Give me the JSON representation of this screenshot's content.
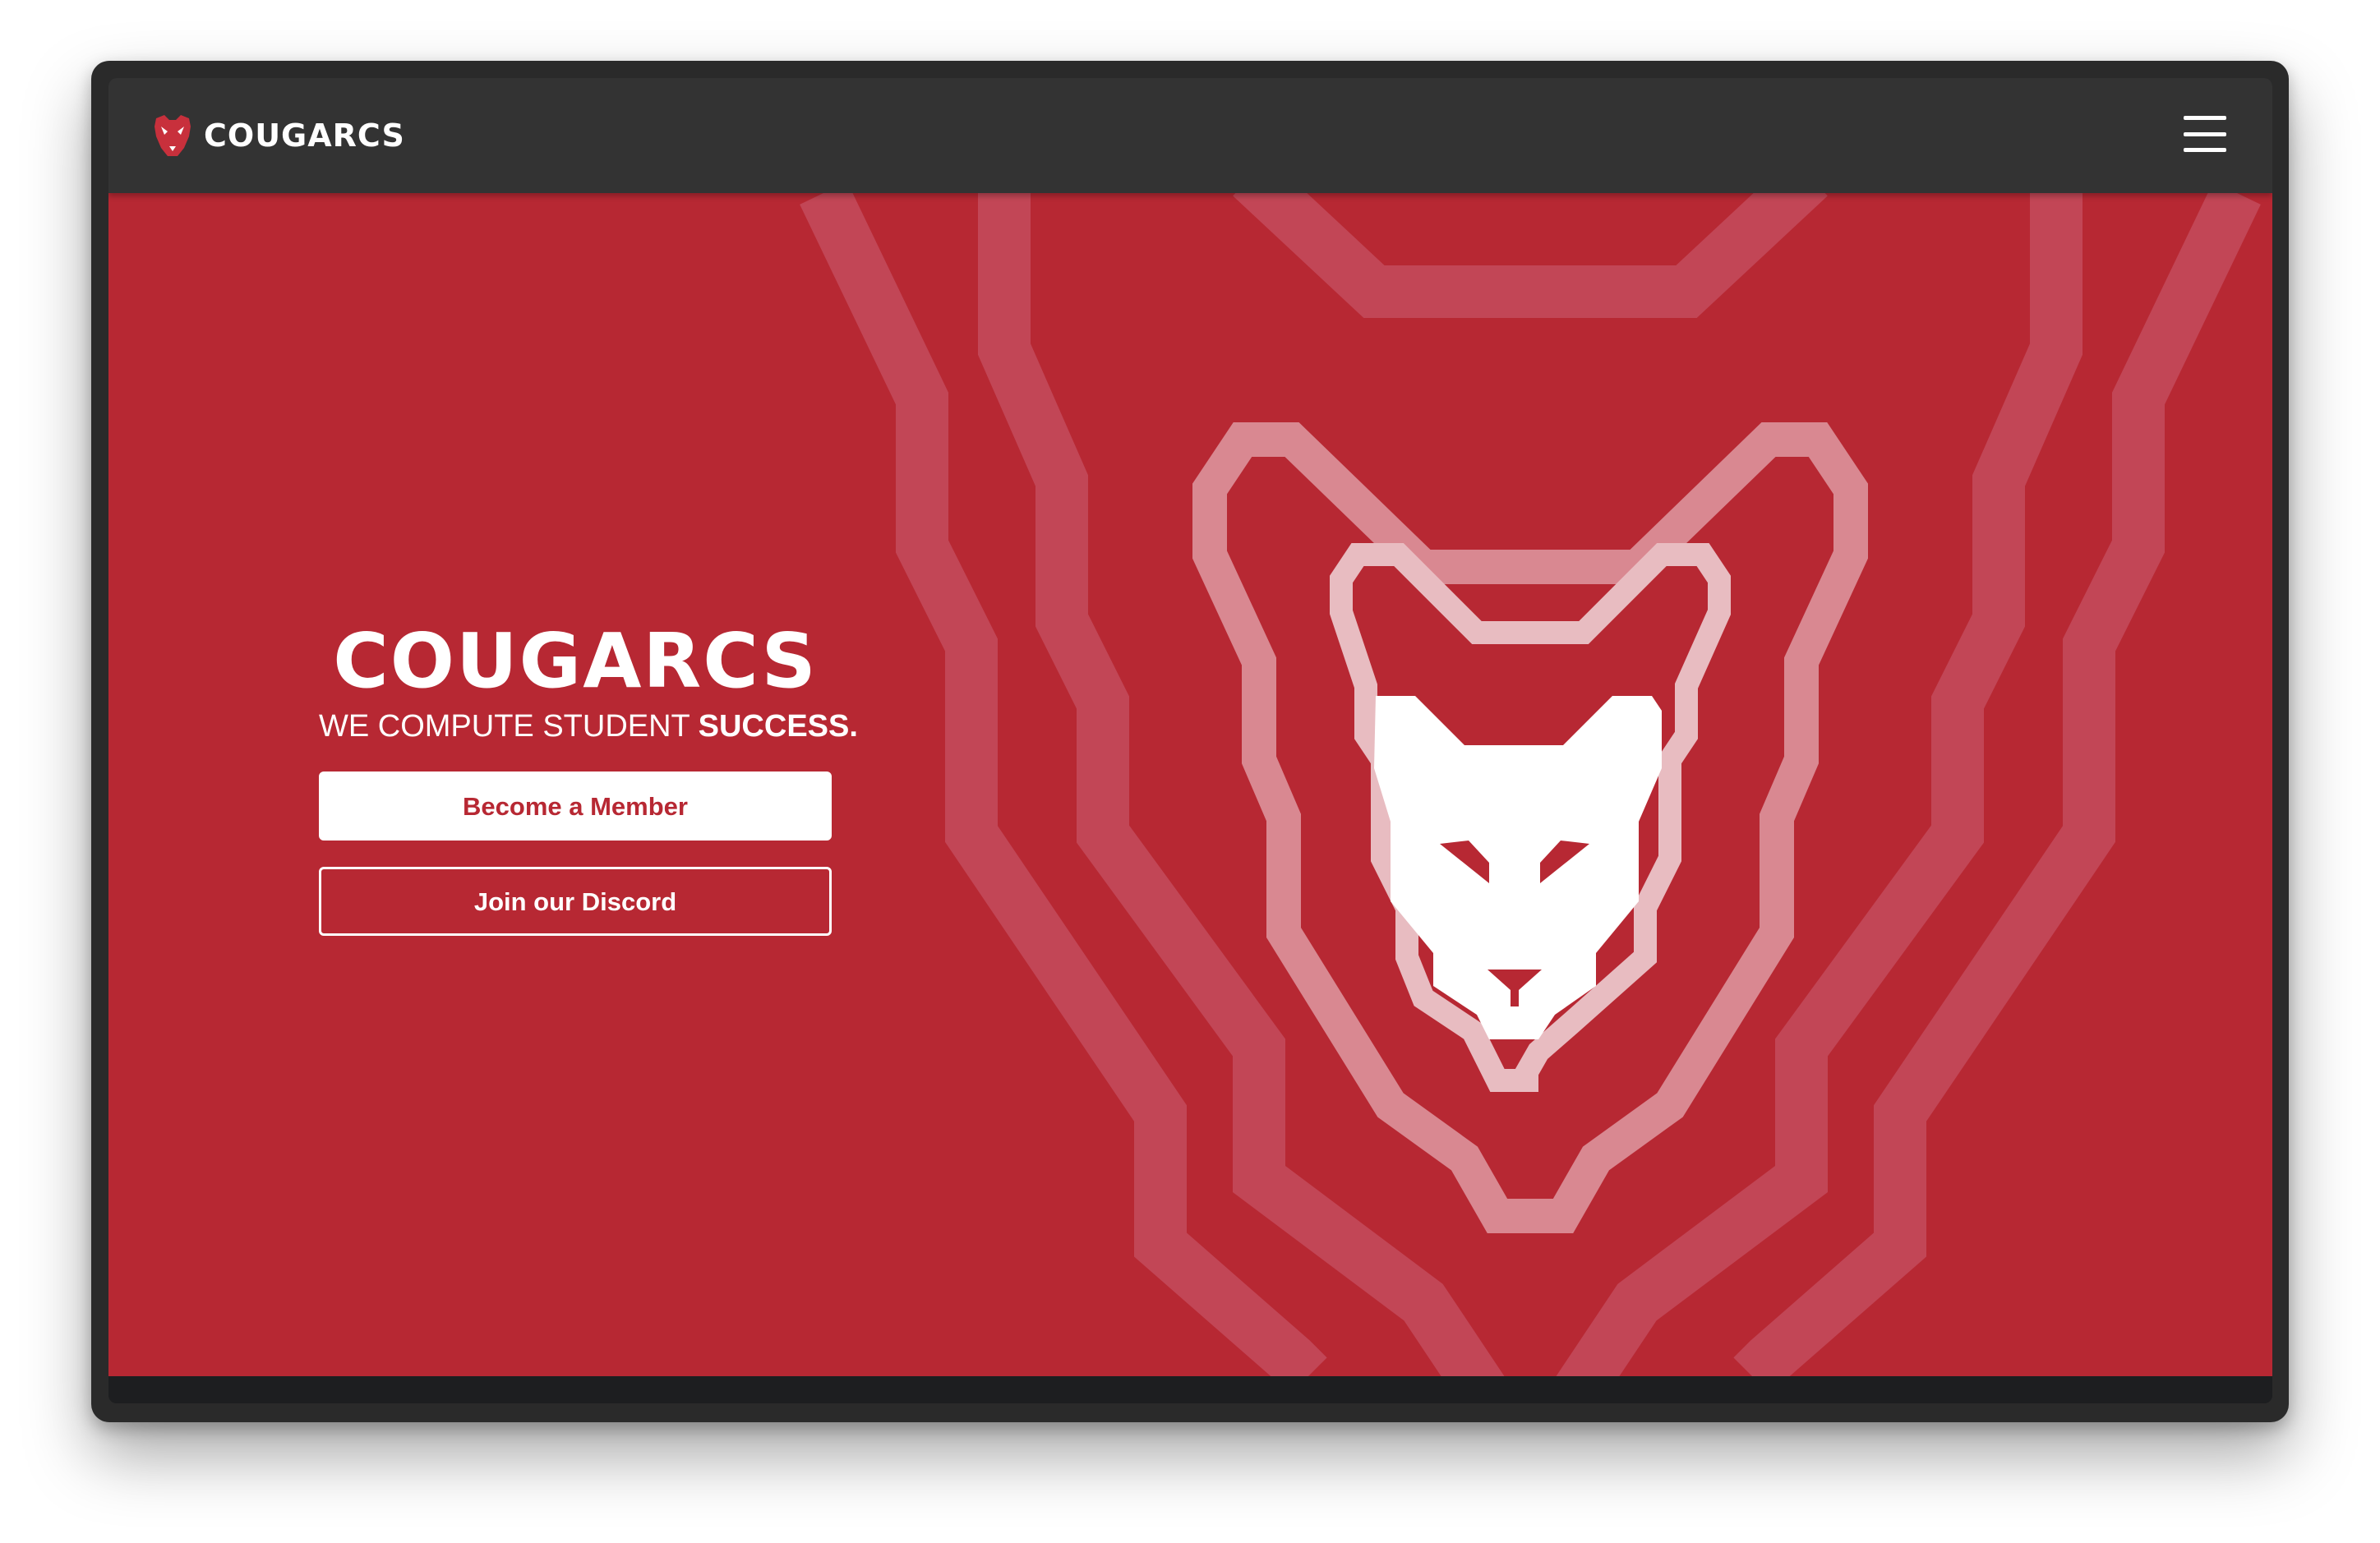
{
  "navbar": {
    "brand": "COUGARCS",
    "logo_icon": "cougar-head-icon",
    "menu_icon": "hamburger-menu-icon"
  },
  "hero": {
    "title": "COUGARCS",
    "tagline_regular": "WE COMPUTE STUDENT ",
    "tagline_bold": "SUCCESS.",
    "primary_button": "Become a Member",
    "secondary_button": "Join our Discord",
    "art_icon": "cougar-head-icon"
  },
  "colors": {
    "brand_red": "#b72833",
    "navbar": "#333333",
    "text": "#ffffff"
  }
}
